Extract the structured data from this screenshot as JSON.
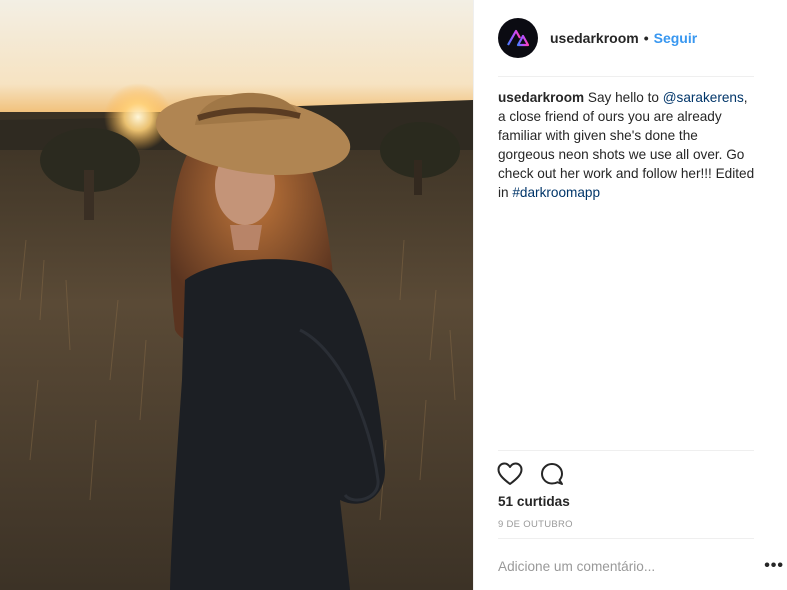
{
  "post": {
    "author": "usedarkroom",
    "follow_label": "Seguir",
    "separator": "•",
    "caption": {
      "author": "usedarkroom",
      "text_before_mention": "Say hello to ",
      "mention": "@sarakerens",
      "text_after_mention": ", a close friend of ours you are already familiar with given she's done the gorgeous neon shots we use all over. Go check out her work and follow her!!! Edited in ",
      "hashtag": "#darkroomapp"
    },
    "likes_text": "51 curtidas",
    "date_text": "9 DE OUTUBRO",
    "comment_placeholder": "Adicione um comentário...",
    "more_label": "•••"
  },
  "icons": {
    "like": "heart-icon",
    "comment": "comment-icon",
    "avatar": "darkroom-logo"
  },
  "colors": {
    "follow": "#3897f0",
    "link": "#003569",
    "muted": "#999999"
  }
}
